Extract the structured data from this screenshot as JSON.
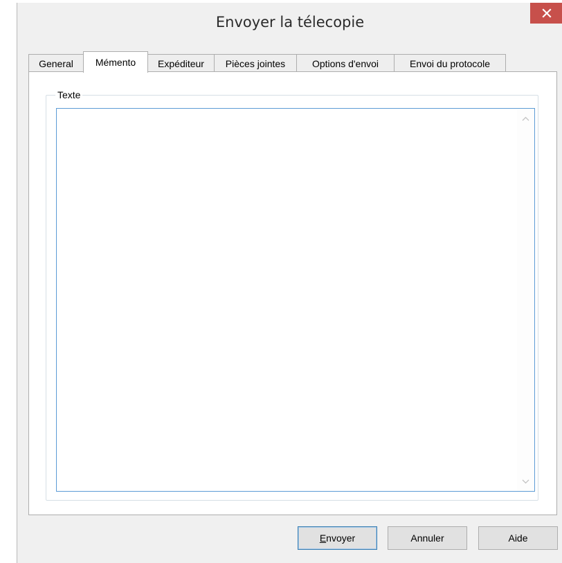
{
  "window": {
    "title": "Envoyer la télecopie",
    "close_icon": "close-icon",
    "close_color": "#c7504b"
  },
  "tabs": [
    {
      "label": "General",
      "active": false
    },
    {
      "label": "Mémento",
      "active": true
    },
    {
      "label": "Expéditeur",
      "active": false
    },
    {
      "label": "Pièces jointes",
      "active": false
    },
    {
      "label": "Options d'envoi",
      "active": false
    },
    {
      "label": "Envoi du protocole",
      "active": false
    }
  ],
  "memo": {
    "group_label": "Texte",
    "text_value": ""
  },
  "buttons": {
    "send_label": "Envoyer",
    "cancel_label": "Annuler",
    "help_label": "Aide"
  }
}
